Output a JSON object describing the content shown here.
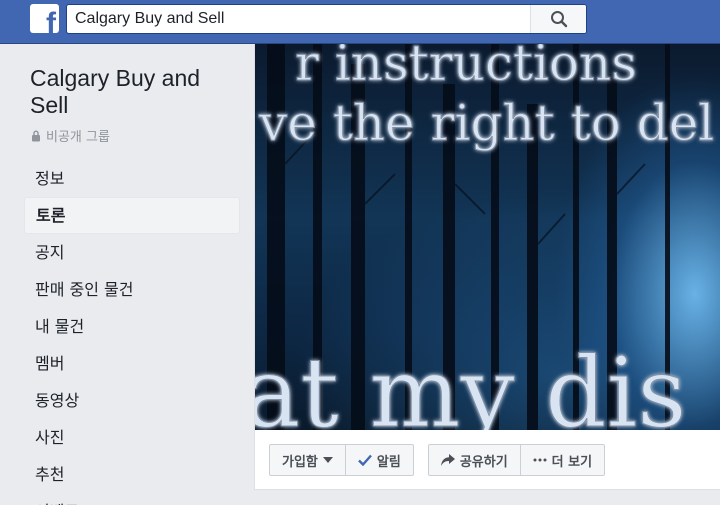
{
  "header": {
    "logo_letter": "f",
    "search_value": "Calgary Buy and Sell"
  },
  "group": {
    "name": "Calgary Buy and Sell",
    "privacy": "비공개 그룹"
  },
  "nav": {
    "items": [
      {
        "label": "정보",
        "active": false
      },
      {
        "label": "토론",
        "active": true
      },
      {
        "label": "공지",
        "active": false
      },
      {
        "label": "판매 중인 물건",
        "active": false
      },
      {
        "label": "내 물건",
        "active": false
      },
      {
        "label": "멤버",
        "active": false
      },
      {
        "label": "동영상",
        "active": false
      },
      {
        "label": "사진",
        "active": false
      },
      {
        "label": "추천",
        "active": false
      },
      {
        "label": "이벤트",
        "active": false
      }
    ]
  },
  "cover": {
    "text_line1": "r instructions",
    "text_line2": "ve the right to del",
    "text_line3": "at my dis"
  },
  "actions": {
    "joined": "가입함",
    "notifications": "알림",
    "share": "공유하기",
    "more": "더 보기"
  },
  "colors": {
    "brand": "#4267b2",
    "check": "#4267b2"
  }
}
